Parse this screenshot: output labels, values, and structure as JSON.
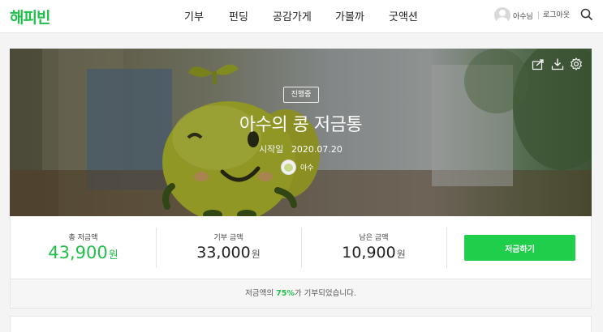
{
  "header": {
    "logo": "해피빈",
    "nav": [
      {
        "label": "기부"
      },
      {
        "label": "펀딩"
      },
      {
        "label": "공감가게"
      },
      {
        "label": "가볼까"
      },
      {
        "label": "굿액션"
      }
    ],
    "user_name": "아수님",
    "logout_label": "로그아웃",
    "icons": {
      "search": "search-icon",
      "avatar": "user-avatar-icon"
    }
  },
  "hero": {
    "status": "진행중",
    "title": "아수의 콩 저금통",
    "start_label": "시작일",
    "start_date": "2020.07.20",
    "owner_name": "아수",
    "tools": [
      "share-icon",
      "download-icon",
      "settings-icon"
    ]
  },
  "stats": {
    "total": {
      "label": "총 저금액",
      "value": "43,900",
      "unit": "원"
    },
    "donated": {
      "label": "기부 금액",
      "value": "33,000",
      "unit": "원"
    },
    "remaining": {
      "label": "남은 금액",
      "value": "10,900",
      "unit": "원"
    },
    "save_button": "저금하기"
  },
  "progress": {
    "prefix": "저금액의 ",
    "percent": "75%",
    "suffix": "가 기부되었습니다."
  },
  "colors": {
    "brand": "#1fbf4a",
    "button": "#1fce4a"
  }
}
